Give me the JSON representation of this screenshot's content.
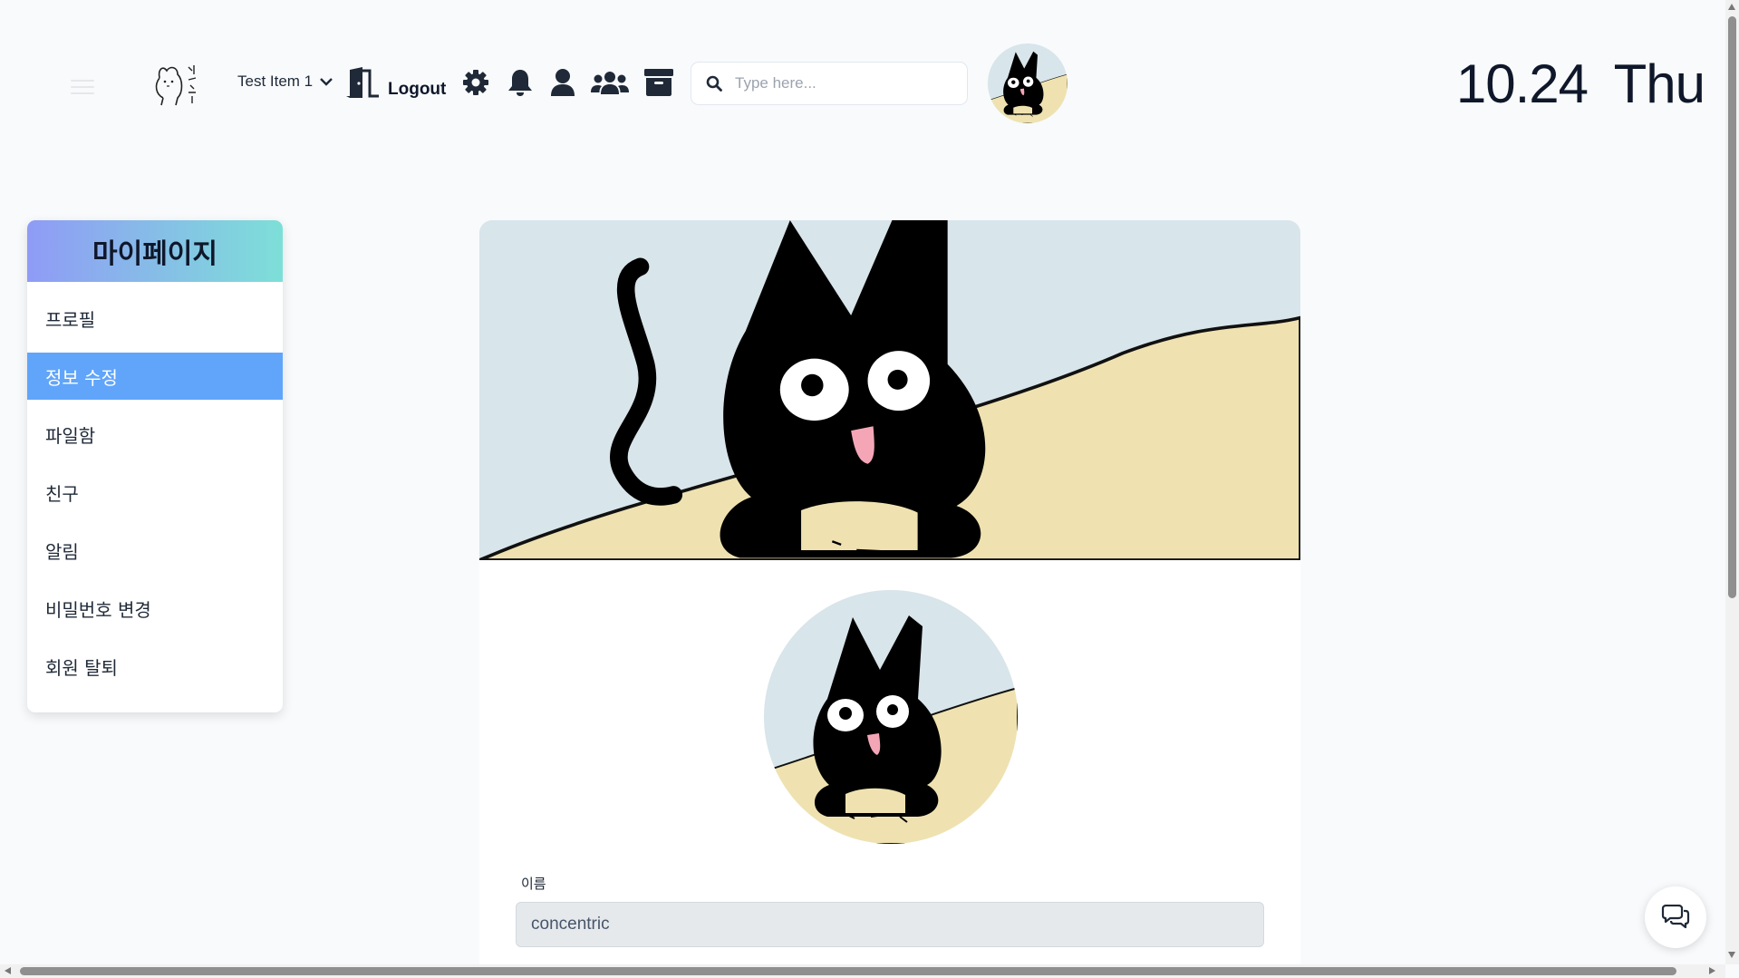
{
  "header": {
    "item_select": {
      "label": "Test Item 1"
    },
    "logout_label": "Logout",
    "search": {
      "placeholder": "Type here..."
    },
    "date": "10.24 Thu",
    "icons": [
      "menu-icon",
      "logo-icon",
      "chevron-down-icon",
      "door-icon",
      "gear-icon",
      "bell-icon",
      "user-icon",
      "users-icon",
      "archive-icon",
      "search-icon",
      "avatar"
    ]
  },
  "sidebar": {
    "title": "마이페이지",
    "items": [
      {
        "label": "프로필",
        "active": false
      },
      {
        "label": "정보 수정",
        "active": true
      },
      {
        "label": "파일함",
        "active": false
      },
      {
        "label": "친구",
        "active": false
      },
      {
        "label": "알림",
        "active": false
      },
      {
        "label": "비밀번호 변경",
        "active": false
      },
      {
        "label": "회원 탈퇴",
        "active": false
      }
    ]
  },
  "profile": {
    "name_label": "이름",
    "name_value": "concentric"
  },
  "colors": {
    "accent": "#60a5fa",
    "gradient_start": "#8f9bf6",
    "gradient_end": "#7ddfd8",
    "cover_sky": "#d8e5ea",
    "cover_ground": "#efe2b0",
    "input_bg": "#e5e9ec"
  }
}
